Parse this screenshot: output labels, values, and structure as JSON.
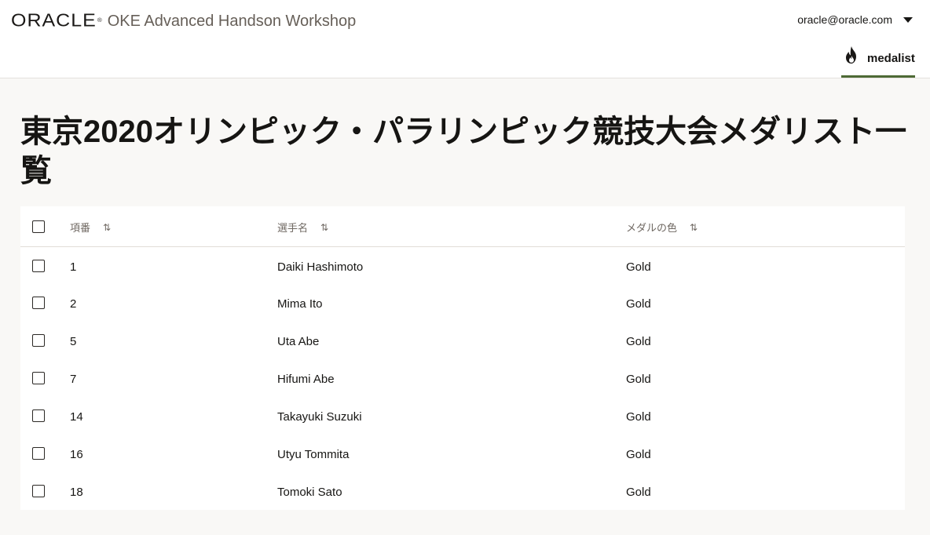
{
  "header": {
    "logo_text": "ORACLE",
    "logo_mark": "®",
    "app_title": "OKE Advanced Handson Workshop",
    "user_email": "oracle@oracle.com",
    "nav_tab_label": "medalist",
    "nav_tab_icon": "fire-icon",
    "accent_color": "#4e6a35"
  },
  "page": {
    "title": "東京2020オリンピック・パラリンピック競技大会メダリスト一覧"
  },
  "table": {
    "columns": [
      {
        "label": "項番",
        "sort_icon": "⇅"
      },
      {
        "label": "選手名",
        "sort_icon": "⇅"
      },
      {
        "label": "メダルの色",
        "sort_icon": "⇅"
      }
    ],
    "rows": [
      {
        "id": "1",
        "name": "Daiki Hashimoto",
        "medal": "Gold"
      },
      {
        "id": "2",
        "name": "Mima Ito",
        "medal": "Gold"
      },
      {
        "id": "5",
        "name": "Uta Abe",
        "medal": "Gold"
      },
      {
        "id": "7",
        "name": "Hifumi Abe",
        "medal": "Gold"
      },
      {
        "id": "14",
        "name": "Takayuki Suzuki",
        "medal": "Gold"
      },
      {
        "id": "16",
        "name": "Utyu Tommita",
        "medal": "Gold"
      },
      {
        "id": "18",
        "name": "Tomoki Sato",
        "medal": "Gold"
      }
    ]
  }
}
